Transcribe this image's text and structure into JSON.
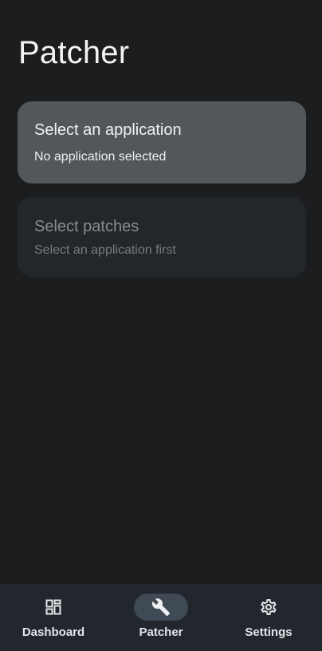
{
  "header": {
    "title": "Patcher"
  },
  "cards": {
    "application": {
      "title": "Select an application",
      "subtitle": "No application selected"
    },
    "patches": {
      "title": "Select patches",
      "subtitle": "Select an application first"
    }
  },
  "bottom_nav": {
    "items": [
      {
        "label": "Dashboard",
        "icon": "dashboard-icon",
        "selected": false
      },
      {
        "label": "Patcher",
        "icon": "wrench-icon",
        "selected": true
      },
      {
        "label": "Settings",
        "icon": "gear-icon",
        "selected": false
      }
    ]
  },
  "colors": {
    "background": "#1c1d1f",
    "card_active": "#53575b",
    "card_disabled": "#23262a",
    "nav_bar": "#22272d",
    "nav_selected_pill": "#404a54"
  }
}
